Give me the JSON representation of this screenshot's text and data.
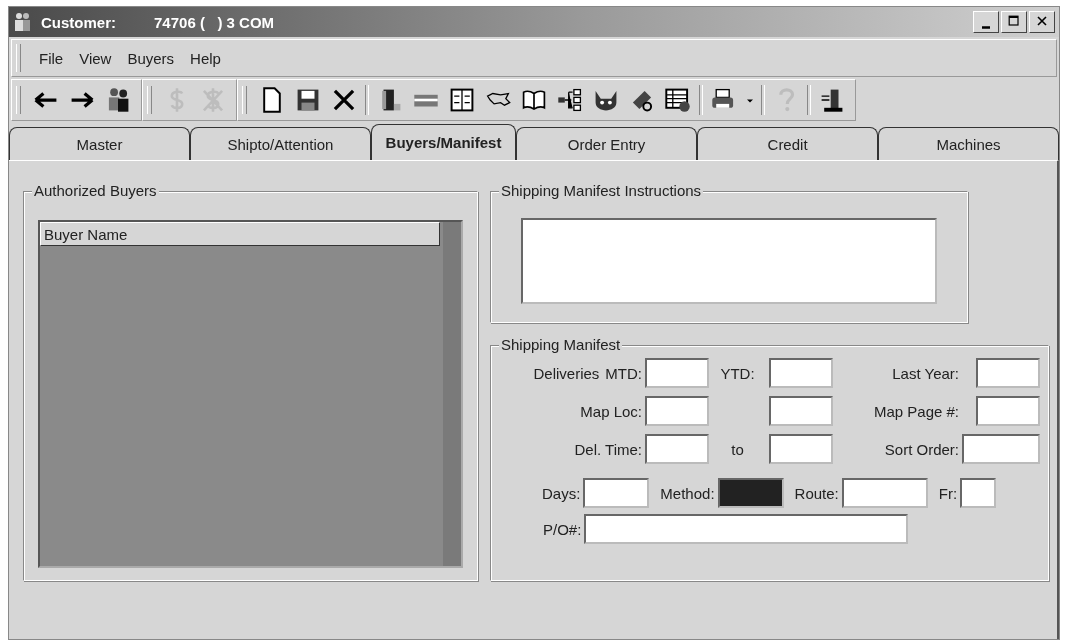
{
  "window": {
    "title_label": "Customer:",
    "title_value": "74706 (   ) 3 COM",
    "controls": [
      {
        "kind": "minimize"
      },
      {
        "kind": "maximize"
      },
      {
        "kind": "close"
      }
    ]
  },
  "menu": [
    {
      "label": "File"
    },
    {
      "label": "View"
    },
    {
      "label": "Buyers"
    },
    {
      "label": "Help"
    }
  ],
  "toolbar": [
    {
      "items": [
        {
          "kind": "back",
          "disabled": false
        },
        {
          "kind": "forward",
          "disabled": false
        },
        {
          "kind": "people",
          "disabled": false
        }
      ]
    },
    {
      "items": [
        {
          "kind": "dollar",
          "disabled": true
        },
        {
          "kind": "dollar-cross",
          "disabled": true
        }
      ]
    },
    {
      "items": [
        {
          "kind": "new",
          "disabled": false
        },
        {
          "kind": "save",
          "disabled": false
        },
        {
          "kind": "delete",
          "disabled": false
        },
        {
          "kind": "separator"
        },
        {
          "kind": "door",
          "disabled": false
        },
        {
          "kind": "card",
          "disabled": false
        },
        {
          "kind": "calendar",
          "disabled": false
        },
        {
          "kind": "map",
          "disabled": false
        },
        {
          "kind": "book",
          "disabled": false
        },
        {
          "kind": "tree",
          "disabled": false
        },
        {
          "kind": "cat",
          "disabled": false
        },
        {
          "kind": "tools",
          "disabled": false
        },
        {
          "kind": "sheet",
          "disabled": false
        },
        {
          "kind": "separator"
        },
        {
          "kind": "printer",
          "disabled": false
        },
        {
          "kind": "separator"
        },
        {
          "kind": "help",
          "disabled": true
        },
        {
          "kind": "separator"
        },
        {
          "kind": "exit",
          "disabled": false
        }
      ]
    }
  ],
  "tabs": [
    {
      "label": "Master",
      "selected": false
    },
    {
      "label": "Shipto/Attention",
      "selected": false
    },
    {
      "label": "Buyers/Manifest",
      "selected": true
    },
    {
      "label": "Order Entry",
      "selected": false
    },
    {
      "label": "Credit",
      "selected": false
    },
    {
      "label": "Machines",
      "selected": false
    }
  ],
  "authorized_buyers": {
    "title": "Authorized Buyers",
    "columns": [
      "Buyer Name"
    ]
  },
  "instructions": {
    "title": "Shipping Manifest Instructions"
  },
  "shipping_manifest": {
    "title": "Shipping Manifest",
    "deliveries_label": "Deliveries",
    "grid": [
      [
        {
          "label": "MTD:",
          "kind": "normal"
        },
        {
          "label": "YTD:",
          "kind": "normal"
        },
        {
          "label": "Last Year:",
          "kind": "normal"
        }
      ],
      [
        {
          "label": "Map Loc:",
          "kind": "normal"
        },
        {
          "kind": "unlabeled"
        },
        {
          "label": "Map Page #:",
          "kind": "normal"
        }
      ],
      [
        {
          "label": "Del. Time:",
          "kind": "normal"
        },
        {
          "label": "to",
          "kind": "normal"
        },
        {
          "label": "Sort Order:",
          "kind": "wide"
        }
      ]
    ],
    "row4": [
      {
        "label": "Days:",
        "kind": "text"
      },
      {
        "label": "Method:",
        "kind": "filled"
      },
      {
        "label": "Route:",
        "kind": "text"
      },
      {
        "label": "Fr:",
        "kind": "small"
      }
    ],
    "po_label": "P/O#:"
  }
}
